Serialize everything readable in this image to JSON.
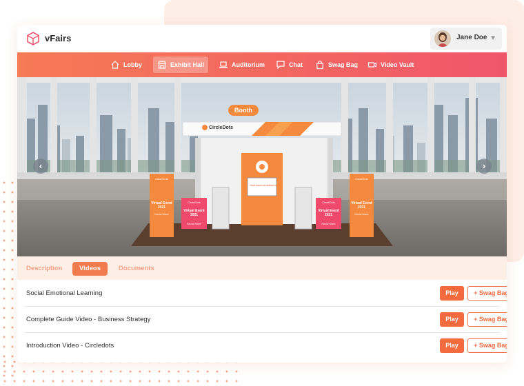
{
  "app": {
    "brand": "vFairs"
  },
  "user": {
    "name": "Jane Doe"
  },
  "nav": [
    {
      "label": "Lobby",
      "icon": "home-icon"
    },
    {
      "label": "Exhibit Hall",
      "icon": "store-icon",
      "active": true
    },
    {
      "label": "Auditorium",
      "icon": "laptop-icon"
    },
    {
      "label": "Chat",
      "icon": "chat-icon"
    },
    {
      "label": "Swag Bag",
      "icon": "bag-icon"
    },
    {
      "label": "Video Vault",
      "icon": "video-icon"
    }
  ],
  "booth": {
    "sign": "Booth",
    "company": "CircleDots",
    "screen_text": "Visit www.circledots.io",
    "banner_logo": "CircleDots",
    "banner_title": "Virtual Event 2021",
    "banner_cta": "Know More"
  },
  "tabs": [
    {
      "label": "Description"
    },
    {
      "label": "Videos",
      "active": true
    },
    {
      "label": "Documents"
    }
  ],
  "videos": [
    {
      "title": "Social Emotional Learning",
      "play": "Play",
      "swag": "+ Swag Bag"
    },
    {
      "title": "Complete Guide Video - Business Strategy",
      "play": "Play",
      "swag": "+ Swag Bag"
    },
    {
      "title": "Introduction Video - Circledots",
      "play": "Play",
      "swag": "+ Swag Bag"
    }
  ],
  "colors": {
    "accent": "#f26a3e",
    "nav_start": "#f67a55",
    "nav_end": "#f0566a",
    "tab_bar": "#fdeee6"
  }
}
